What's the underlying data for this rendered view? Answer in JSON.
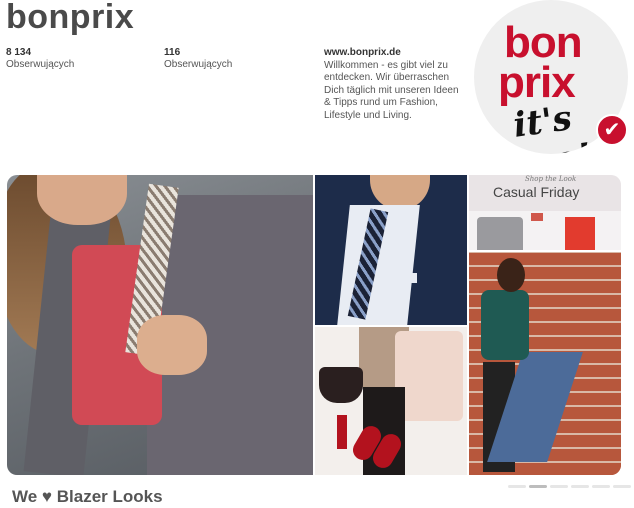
{
  "profile": {
    "name": "bonprix",
    "stats": [
      {
        "count": "8 134",
        "label": "Obserwujących"
      },
      {
        "count": "116",
        "label": "Obserwujących"
      }
    ],
    "website": "www.bonprix.de",
    "description": "Willkommen - es gibt viel zu entdecken. Wir überraschen Dich täglich mit unseren Ideen & Tipps rund um Fashion, Lifestyle und Living."
  },
  "avatar": {
    "logo_line1": "bon",
    "logo_line2": "prix",
    "tagline": "it's me!",
    "verified_icon": "checkmark-icon",
    "brand_color": "#c8102e"
  },
  "board": {
    "title": "We ♥ Blazer Looks",
    "casual_script": "Shop the Look",
    "casual_title": "Casual Friday",
    "page_indicator_count": 6,
    "active_page": 2
  }
}
